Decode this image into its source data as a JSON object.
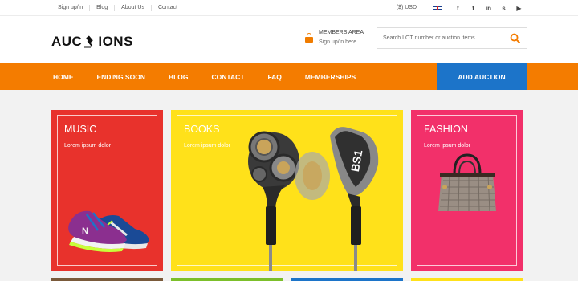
{
  "topbar": {
    "links": [
      "Sign up/in",
      "Blog",
      "About Us",
      "Contact"
    ],
    "currency": "($) USD",
    "social_icons": [
      "twitter-icon",
      "facebook-icon",
      "linkedin-icon",
      "skype-icon",
      "youtube-icon"
    ],
    "social_glyphs": [
      "t",
      "f",
      "in",
      "s",
      "▶"
    ]
  },
  "header": {
    "logo_left": "AUC",
    "logo_right": "IONS",
    "members_title": "MEMBERS AREA",
    "members_link": "Sign up/in here",
    "search_placeholder": "Search LOT number or auction items"
  },
  "nav": {
    "items": [
      "HOME",
      "ENDING SOON",
      "BLOG",
      "CONTACT",
      "FAQ",
      "MEMBERSHIPS"
    ],
    "add_auction": "ADD AUCTION"
  },
  "cards": [
    {
      "title": "MUSIC",
      "subtitle": "Lorem ipsum dolor",
      "color": "#e8322c"
    },
    {
      "title": "BOOKS",
      "subtitle": "Lorem ipsum dolor",
      "color": "#ffe11a"
    },
    {
      "title": "FASHION",
      "subtitle": "Lorem ipsum dolor",
      "color": "#f2306a"
    }
  ],
  "earbud_label": "BS1",
  "colors": {
    "accent": "#f47c00",
    "add_auction": "#1c74c9"
  }
}
